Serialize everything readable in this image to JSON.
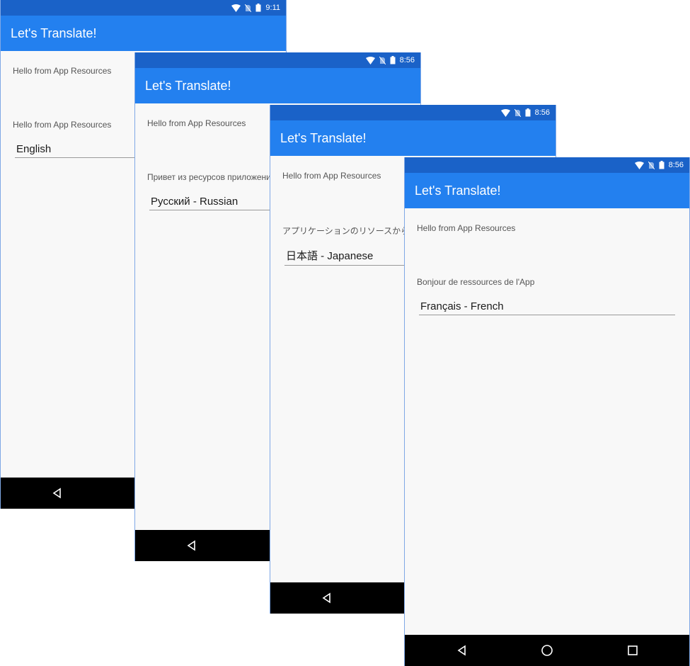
{
  "app": {
    "title": "Let's Translate!"
  },
  "screens": [
    {
      "language": "English",
      "time": "9:11",
      "app_resources_label": "Hello from App Resources",
      "localized_label": "Hello from App Resources",
      "picker_value": "English"
    },
    {
      "language": "Russian",
      "time": "8:56",
      "app_resources_label": "Hello from App Resources",
      "localized_label": "Привет из ресурсов приложения",
      "picker_value": "Русский - Russian"
    },
    {
      "language": "Japanese",
      "time": "8:56",
      "app_resources_label": "Hello from App Resources",
      "localized_label": "アプリケーションのリソースから",
      "picker_value": "日本語 - Japanese"
    },
    {
      "language": "French",
      "time": "8:56",
      "app_resources_label": "Hello from App Resources",
      "localized_label": "Bonjour de ressources de l'App",
      "picker_value": "Français - French"
    }
  ],
  "colors": {
    "status_bar": "#1a62c8",
    "app_bar": "#2380ef",
    "background": "#f8f8f8",
    "nav_bar": "#000000"
  },
  "icons": {
    "status": [
      "wifi-icon",
      "no-sim-icon",
      "battery-icon"
    ],
    "nav": [
      "back-icon",
      "home-icon",
      "recents-icon"
    ]
  }
}
